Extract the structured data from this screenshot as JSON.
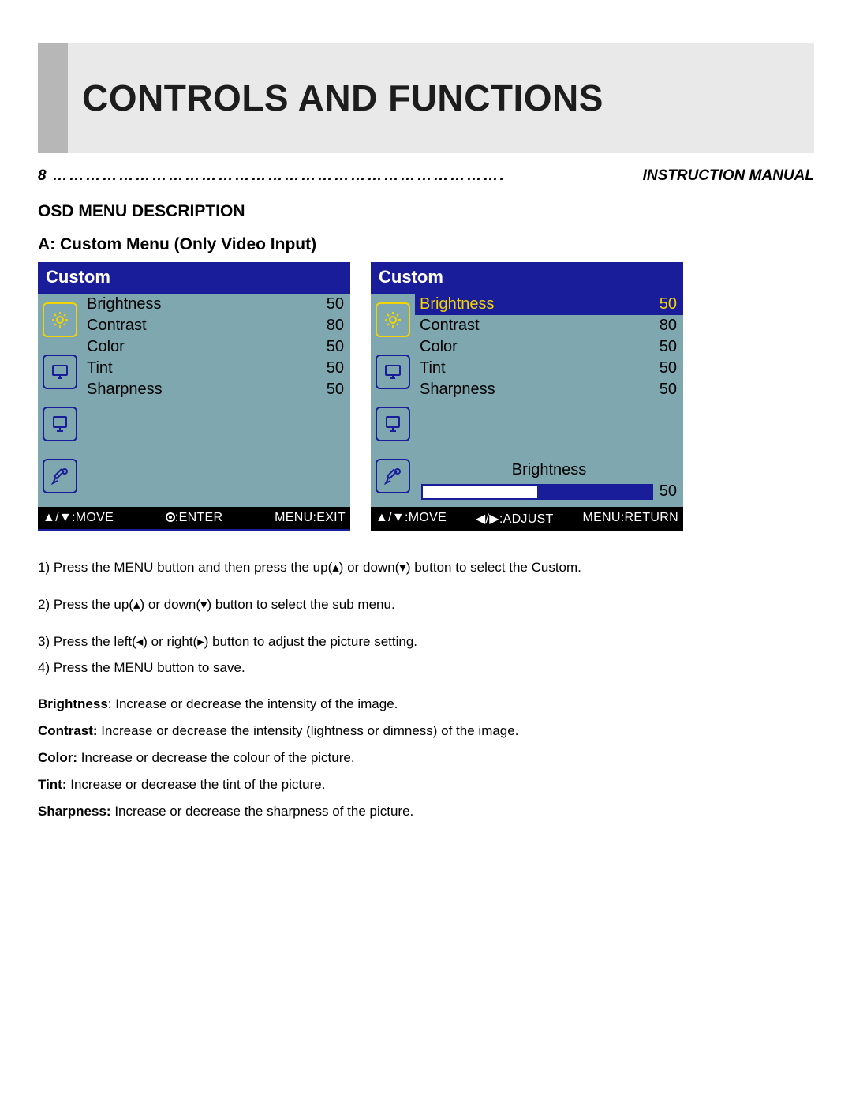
{
  "banner_title": "Controls And Functions",
  "page_number": "8",
  "header_dots": "……………………………………………………………………….",
  "header_right": "INSTRUCTION MANUAL",
  "section_heading": "OSD MENU DESCRIPTION",
  "sub_heading": "A: Custom Menu (Only Video Input)",
  "osd": {
    "left": {
      "title": "Custom",
      "items": [
        {
          "label": "Brightness",
          "value": "50"
        },
        {
          "label": "Contrast",
          "value": "80"
        },
        {
          "label": "Color",
          "value": "50"
        },
        {
          "label": "Tint",
          "value": "50"
        },
        {
          "label": "Sharpness",
          "value": "50"
        }
      ],
      "footer": {
        "move": "▲/▼:MOVE",
        "enter": ":ENTER",
        "exit": "MENU:EXIT"
      }
    },
    "right": {
      "title": "Custom",
      "selected_index": 0,
      "items": [
        {
          "label": "Brightness",
          "value": "50"
        },
        {
          "label": "Contrast",
          "value": "80"
        },
        {
          "label": "Color",
          "value": "50"
        },
        {
          "label": "Tint",
          "value": "50"
        },
        {
          "label": "Sharpness",
          "value": "50"
        }
      ],
      "adjust": {
        "label": "Brightness",
        "value": "50",
        "percent": 50
      },
      "footer": {
        "move": "▲/▼:MOVE",
        "adjust": "◀/▶:ADJUST",
        "return": "MENU:RETURN"
      }
    }
  },
  "instructions": {
    "step1": "1) Press the MENU button and then press the up(▴) or down(▾) button to select the Custom.",
    "step2": "2) Press the up(▴) or down(▾) button to select the sub menu.",
    "step3": "3) Press the left(◂) or right(▸) button to adjust the picture setting.",
    "step4": "4) Press the MENU button to save."
  },
  "definitions": [
    {
      "term": "Brightness",
      "text": ": Increase or decrease the intensity of the image."
    },
    {
      "term": "Contrast:",
      "text": " Increase or decrease the intensity (lightness or dimness) of the image."
    },
    {
      "term": "Color:",
      "text": " Increase or decrease the colour of the picture."
    },
    {
      "term": "Tint:",
      "text": " Increase or decrease the tint of the picture."
    },
    {
      "term": "Sharpness:",
      "text": " Increase or decrease the sharpness of the picture."
    }
  ]
}
